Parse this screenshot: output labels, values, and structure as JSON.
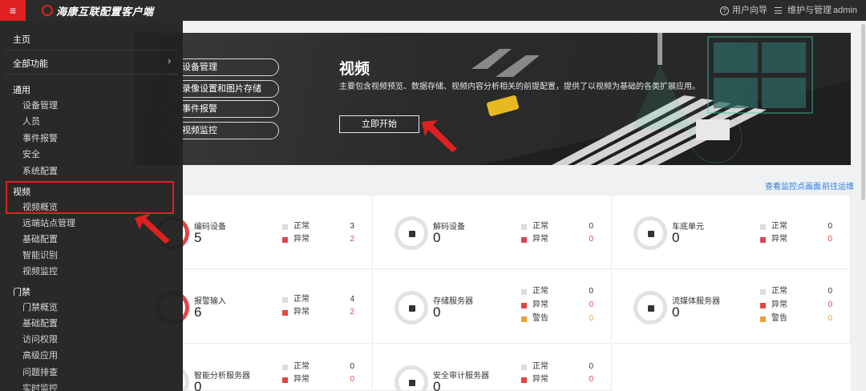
{
  "topbar": {
    "menu_glyph": "≡",
    "brand": "海康互联配置客户端",
    "user_guide": "用户向导",
    "maintenance": "维护与管理",
    "user": "admin",
    "user_guide_icon": "?",
    "icons": [
      "menu-icon",
      "brand-logo-icon",
      "question-circle-icon",
      "list-icon"
    ],
    "accent": "#e02020"
  },
  "banner": {
    "pills": [
      "设备管理",
      "录像设置和图片存储",
      "事件报警",
      "视频监控"
    ],
    "title": "视频",
    "desc": "主要包含视频预览、数据存储、视频内容分析相关的前提配置，提供了以视频为基础的各类扩展应用。",
    "start": "立即开始"
  },
  "links": {
    "view_points": "查看监控点画面",
    "goto_ops": "前往运维"
  },
  "cards": [
    {
      "name": "编码设备",
      "count": "5",
      "stats": [
        {
          "label": "正常",
          "value": "3"
        },
        {
          "label": "异常",
          "value": "2"
        }
      ]
    },
    {
      "name": "解码设备",
      "count": "0",
      "stats": [
        {
          "label": "正常",
          "value": "0"
        },
        {
          "label": "异常",
          "value": "0"
        }
      ]
    },
    {
      "name": "车底单元",
      "count": "0",
      "stats": [
        {
          "label": "正常",
          "value": "0"
        },
        {
          "label": "异常",
          "value": "0"
        }
      ]
    },
    {
      "name": "报警输入",
      "count": "6",
      "stats": [
        {
          "label": "正常",
          "value": "4"
        },
        {
          "label": "异常",
          "value": "2"
        }
      ]
    },
    {
      "name": "存储服务器",
      "count": "0",
      "stats": [
        {
          "label": "正常",
          "value": "0"
        },
        {
          "label": "异常",
          "value": "0"
        },
        {
          "label": "警告",
          "value": "0"
        }
      ]
    },
    {
      "name": "流媒体服务器",
      "count": "0",
      "stats": [
        {
          "label": "正常",
          "value": "0"
        },
        {
          "label": "异常",
          "value": "0"
        },
        {
          "label": "警告",
          "value": "0"
        }
      ]
    },
    {
      "name": "智能分析服务器",
      "count": "0",
      "stats": [
        {
          "label": "正常",
          "value": "0"
        },
        {
          "label": "异常",
          "value": "0"
        }
      ]
    },
    {
      "name": "安全审计服务器",
      "count": "0",
      "stats": [
        {
          "label": "正常",
          "value": "0"
        },
        {
          "label": "异常",
          "value": "0"
        }
      ]
    }
  ],
  "sidebar": {
    "home": "主页",
    "all_functions": "全部功能",
    "chevron": "›",
    "groups": {
      "general": {
        "title": "通用",
        "items": [
          "设备管理",
          "人员",
          "事件报警",
          "安全",
          "系统配置"
        ]
      },
      "video": {
        "title": "视频",
        "items": [
          "视频概览",
          "远端站点管理",
          "基础配置",
          "智能识别",
          "视频监控"
        ]
      },
      "access": {
        "title": "门禁",
        "items": [
          "门禁概览",
          "基础配置",
          "访问权限",
          "高级应用",
          "问题排查",
          "实时监控"
        ]
      }
    }
  },
  "colors": {
    "error": "#e24545",
    "warning": "#f0a030",
    "link": "#2a7ae2",
    "sidebar_bg": "#222222"
  }
}
